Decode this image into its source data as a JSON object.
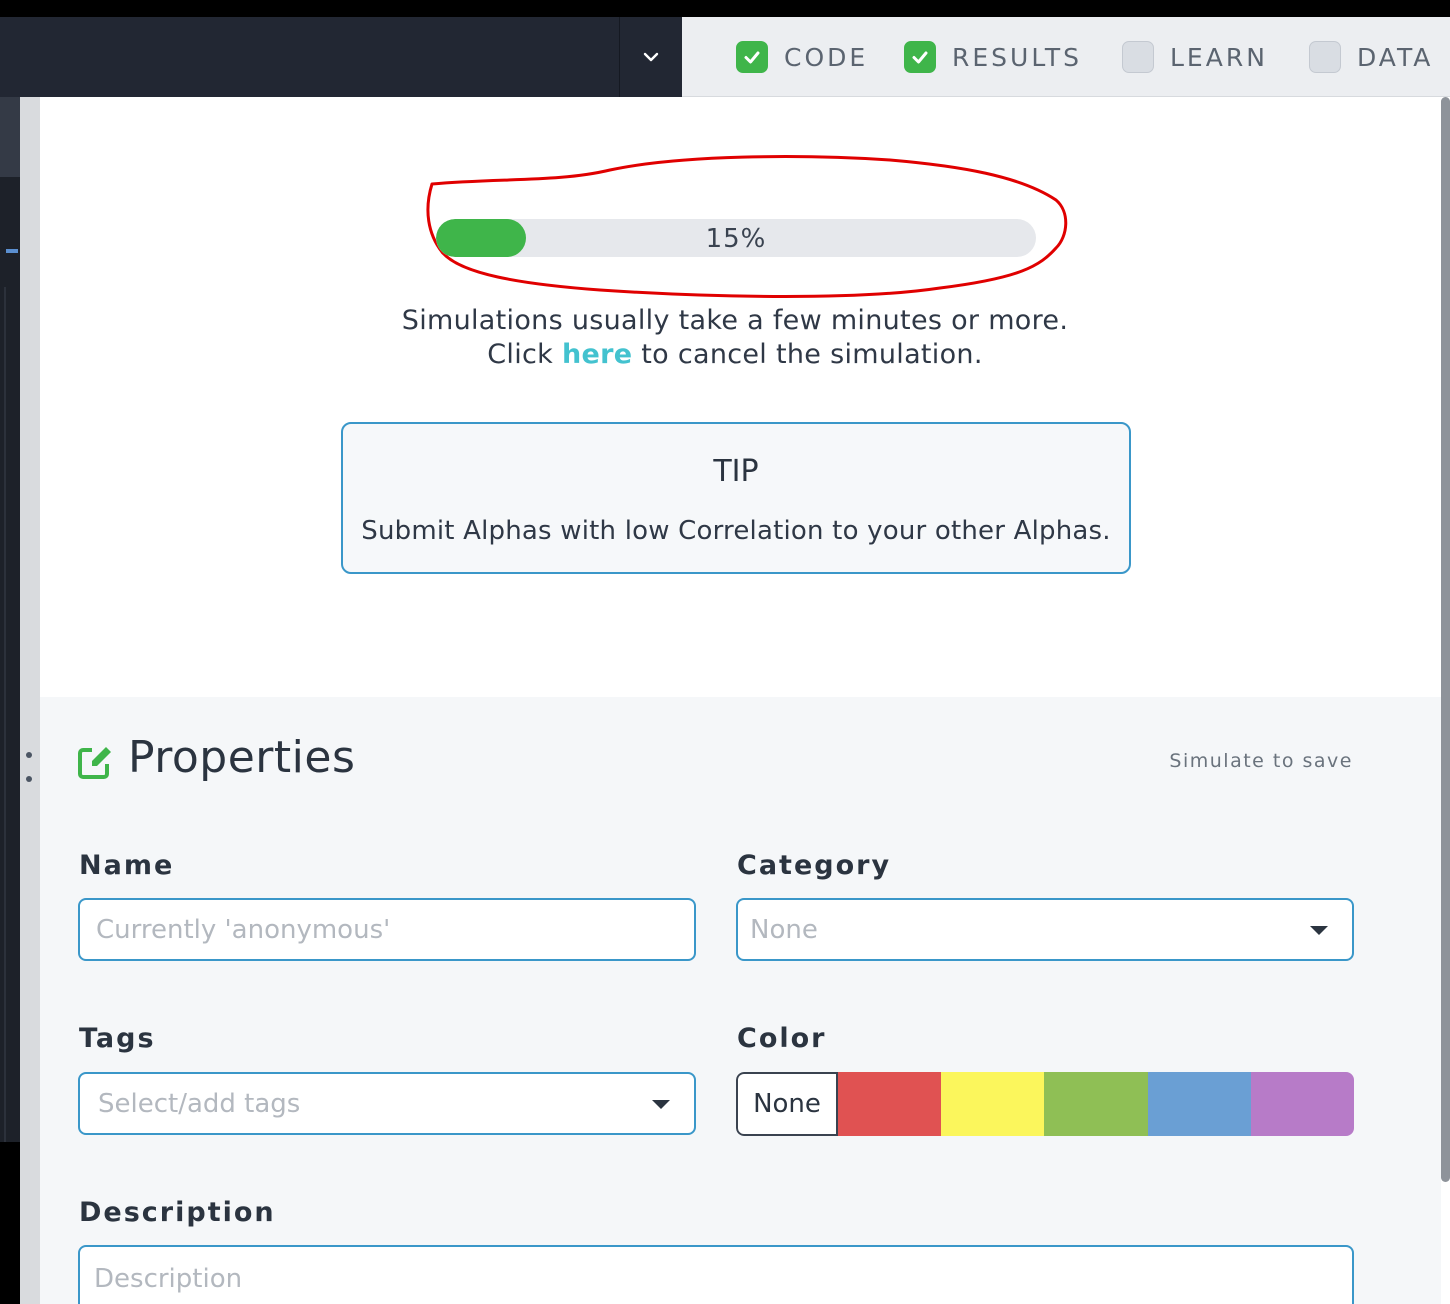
{
  "tabs": [
    {
      "label": "CODE",
      "checked": true
    },
    {
      "label": "RESULTS",
      "checked": true
    },
    {
      "label": "LEARN",
      "checked": false
    },
    {
      "label": "DATA",
      "checked": false
    }
  ],
  "progress": {
    "fraction": 0.15,
    "label": "15%",
    "color": "#3fb54a"
  },
  "simulation": {
    "message_line1": "Simulations usually take a few minutes or more.",
    "cancel_prefix": "Click",
    "cancel_link": "here",
    "cancel_suffix": "to cancel the simulation."
  },
  "tip": {
    "title": "TIP",
    "body": "Submit Alphas with low Correlation to your other Alphas."
  },
  "properties": {
    "title": "Properties",
    "save_status": "Simulate to save",
    "name": {
      "label": "Name",
      "placeholder": "Currently 'anonymous'"
    },
    "category": {
      "label": "Category",
      "value": "None"
    },
    "tags": {
      "label": "Tags",
      "placeholder": "Select/add tags"
    },
    "color": {
      "label": "Color",
      "none_label": "None",
      "swatches": [
        "#e05252",
        "#fbf65c",
        "#8fbf55",
        "#6a9fd4",
        "#b77bc8"
      ]
    },
    "description": {
      "label": "Description",
      "placeholder": "Description"
    }
  },
  "annotation_color": "#e00000"
}
